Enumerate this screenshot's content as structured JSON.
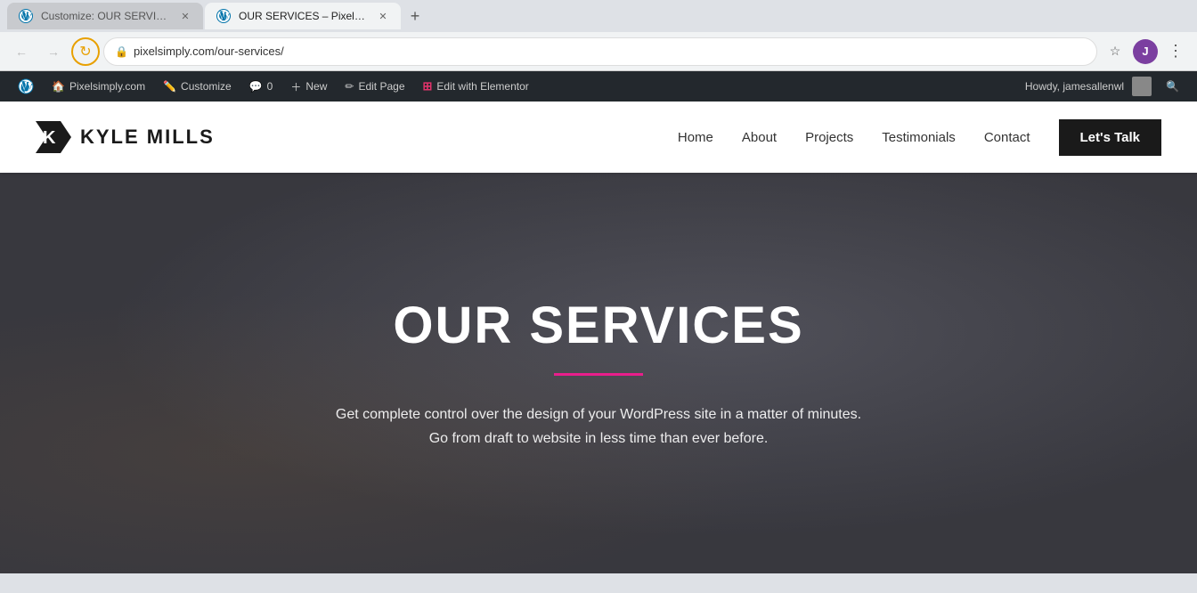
{
  "browser": {
    "tabs": [
      {
        "id": "tab1",
        "favicon": "W",
        "title": "Customize: OUR SERVICES – Pixe...",
        "active": false,
        "url": ""
      },
      {
        "id": "tab2",
        "favicon": "W",
        "title": "OUR SERVICES – Pixelsimply.com",
        "active": true,
        "url": "pixelsimply.com/our-services/"
      }
    ],
    "new_tab_label": "+",
    "address": "pixelsimply.com/our-services/",
    "profile_initial": "J"
  },
  "wp_admin_bar": {
    "items": [
      {
        "id": "wp-logo",
        "label": ""
      },
      {
        "id": "site-name",
        "label": "Pixelsimply.com",
        "icon": "home"
      },
      {
        "id": "customize",
        "label": "Customize",
        "icon": "edit"
      },
      {
        "id": "comments",
        "label": "0",
        "icon": "comment"
      },
      {
        "id": "new",
        "label": "New",
        "icon": "plus"
      },
      {
        "id": "edit-page",
        "label": "Edit Page",
        "icon": "edit"
      },
      {
        "id": "edit-elementor",
        "label": "Edit with Elementor",
        "icon": "elementor"
      }
    ],
    "right": {
      "howdy": "Howdy, jamesallenwl",
      "search_icon": "search"
    }
  },
  "site_header": {
    "logo_text": "KYLE MILLS",
    "nav_links": [
      {
        "id": "home",
        "label": "Home"
      },
      {
        "id": "about",
        "label": "About"
      },
      {
        "id": "projects",
        "label": "Projects"
      },
      {
        "id": "testimonials",
        "label": "Testimonials"
      },
      {
        "id": "contact",
        "label": "Contact"
      }
    ],
    "cta_button": "Let's Talk"
  },
  "hero": {
    "title": "OUR SERVICES",
    "description": "Get complete control over the design of your WordPress site in a matter of minutes. Go from draft to website in less time than ever before."
  }
}
